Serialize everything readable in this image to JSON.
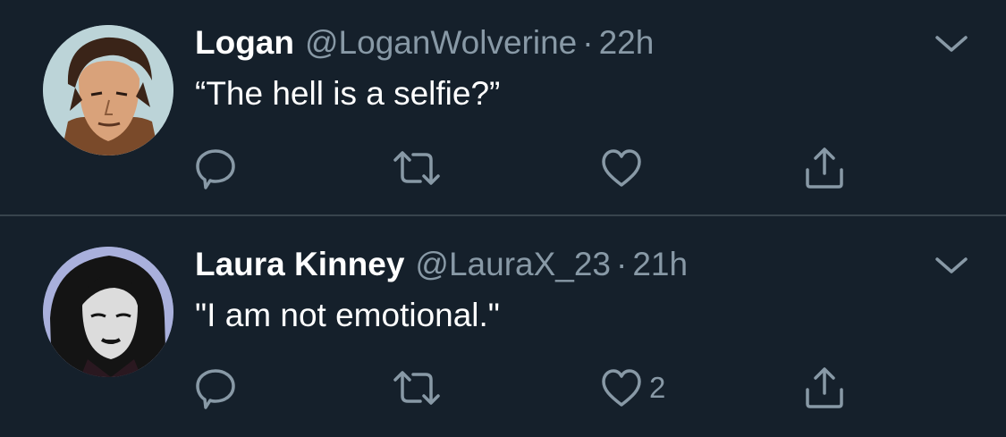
{
  "colors": {
    "background": "#15202b",
    "divider": "#38444d",
    "primary_text": "#ffffff",
    "secondary_text": "#8899a6"
  },
  "tweets": [
    {
      "display_name": "Logan",
      "handle": "@LoganWolverine",
      "separator": "·",
      "time": "22h",
      "text": "“The hell is a selfie?”",
      "like_count": "",
      "icons": [
        "reply-icon",
        "retweet-icon",
        "like-icon",
        "share-icon",
        "chevron-down-icon"
      ]
    },
    {
      "display_name": "Laura Kinney",
      "handle": "@LauraX_23",
      "separator": "·",
      "time": "21h",
      "text": "\"I am not emotional.\"",
      "like_count": "2",
      "icons": [
        "reply-icon",
        "retweet-icon",
        "like-icon",
        "share-icon",
        "chevron-down-icon"
      ]
    }
  ]
}
